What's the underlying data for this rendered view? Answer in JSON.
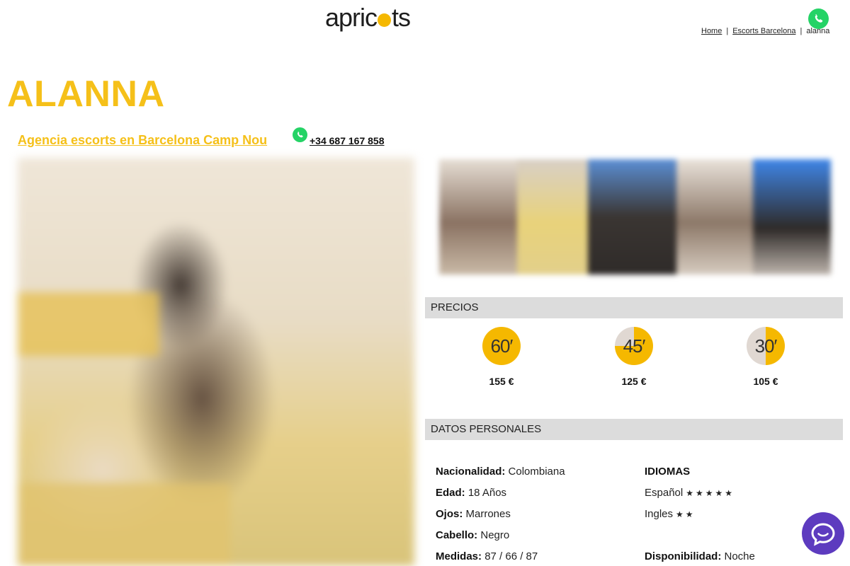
{
  "header": {
    "logo_text_a": "apric",
    "logo_text_b": "ts",
    "breadcrumb": {
      "home": "Home",
      "section": "Escorts Barcelona",
      "current": "alanna",
      "sep": "|"
    }
  },
  "profile": {
    "title": "ALANNA",
    "agency_link": "Agencia escorts en Barcelona Camp Nou",
    "phone": "+34 687 167 858"
  },
  "prices": {
    "heading": "PRECIOS",
    "items": [
      {
        "duration": "60′",
        "price": "155 €",
        "fill_fraction": 1.0
      },
      {
        "duration": "45′",
        "price": "125 €",
        "fill_fraction": 0.75
      },
      {
        "duration": "30′",
        "price": "105 €",
        "fill_fraction": 0.5
      }
    ]
  },
  "personal": {
    "heading": "DATOS PERSONALES",
    "nationality_label": "Nacionalidad:",
    "nationality": "Colombiana",
    "age_label": "Edad:",
    "age": "18 Años",
    "eyes_label": "Ojos:",
    "eyes": "Marrones",
    "hair_label": "Cabello:",
    "hair": "Negro",
    "measures_label": "Medidas:",
    "measures": "87 / 66 / 87",
    "languages_heading": "IDIOMAS",
    "languages": [
      {
        "name": "Español",
        "stars": "★★★★★",
        "rating": 5
      },
      {
        "name": "Ingles",
        "stars": "★★",
        "rating": 2
      }
    ],
    "availability_label": "Disponibilidad:",
    "availability": "Noche"
  },
  "colors": {
    "accent": "#f5c019",
    "clock_fill": "#f5b800",
    "clock_empty": "#e0d8d2",
    "whatsapp": "#25d366",
    "chat": "#5d3bbf",
    "section_bg": "#dcdcdc"
  },
  "icons": {
    "whatsapp": "whatsapp-icon",
    "chat": "chat-icon",
    "star": "star-icon"
  }
}
